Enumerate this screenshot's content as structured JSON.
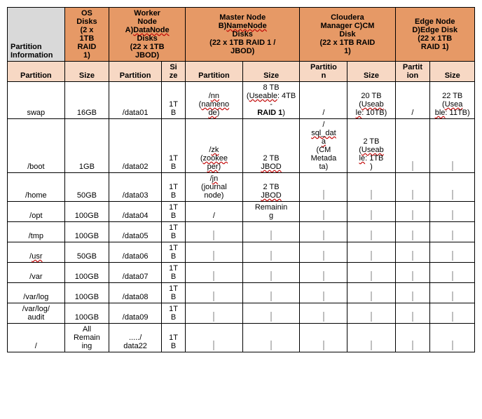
{
  "headers": {
    "corner": "Partition Information",
    "groups": [
      {
        "line1": "OS",
        "line2": "Disks",
        "line3": "(2 x",
        "line4": "1TB",
        "line5": "RAID",
        "line6": "1)"
      },
      {
        "line1": "Worker",
        "line2": "Node",
        "line3a": "A)",
        "line3b": "DataNode",
        "line4": "Disks",
        "line5": "(22 x 1TB",
        "line6": "JBOD)"
      },
      {
        "line1": "Master Node",
        "line2a": "B)",
        "line2b": "NameNode",
        "line3": "Disks",
        "line4": "(22 x 1TB RAID 1 /",
        "line5": "JBOD)"
      },
      {
        "line1": "Cloudera",
        "line2": "Manager C)CM",
        "line3": "Disk",
        "line4": "(22 x 1TB RAID",
        "line5": "1)"
      },
      {
        "line1": "Edge Node",
        "line2": "D)Edge Disk",
        "line3": "(22 x 1TB",
        "line4": "RAID 1)"
      }
    ],
    "sub": {
      "partition": "Partition",
      "size": "Size",
      "sizeShort": "Size",
      "partShort": "Partition"
    }
  },
  "rows": [
    {
      "os_part": "swap",
      "os_size": "16GB",
      "wn_part": "/data01",
      "wn_size": "1TB",
      "mn_part": "/",
      "mn_part_sq": "nn",
      "mn_part2": "(",
      "mn_part3": "nameno",
      "mn_part4": "de",
      "mn_part5": ")",
      "mn_size_l1": "8 TB",
      "mn_size_l2": "(",
      "mn_size_l3": "Useable",
      "mn_size_l4": ": 4TB -",
      "mn_size_l5": "RAID 1",
      "cm_part": "/",
      "cm_size_l1": "20 TB",
      "cm_size_l2": "(",
      "cm_size_l3": "Useab",
      "cm_size_l4": "le",
      "cm_size_l5": ": 10TB)",
      "en_part": "/",
      "en_size_l1": "22 TB",
      "en_size_l2": "(",
      "en_size_l3": "Usea",
      "en_size_l4": "ble",
      "en_size_l5": ": 11TB)"
    },
    {
      "os_part": "/boot",
      "os_size": "1GB",
      "wn_part": "/data02",
      "wn_size": "1TB",
      "mn_part": "/",
      "mn_part_sq": "zk",
      "mn_part2": "(",
      "mn_part3": "zookee",
      "mn_part4": "per",
      "mn_part5": ")",
      "mn_size_l1": "2 TB",
      "mn_size_l2": "JBOD",
      "cm_part": "/",
      "cm_part_sq": "sql_dat",
      "cm_part2": "a",
      "cm_part3": "(CM",
      "cm_part4": "Metada",
      "cm_part5": "ta)",
      "cm_size_l1": "2 TB",
      "cm_size_l2": "(",
      "cm_size_l3": "Useab",
      "cm_size_l4": "le",
      "cm_size_l5": ": 1TB",
      "cm_size_l6": ")"
    },
    {
      "os_part": "/home",
      "os_size": "50GB",
      "wn_part": "/data03",
      "wn_size": "1TB",
      "mn_part": "/",
      "mn_part_sq": "jn",
      "mn_part2": "(journal",
      "mn_part3": "node)",
      "mn_size_l1": "2 TB",
      "mn_size_l2": "JBOD"
    },
    {
      "os_part": "/opt",
      "os_size": "100GB",
      "wn_part": "/data04",
      "wn_size": "1TB",
      "mn_part_plain": "/",
      "mn_size_l1": "Remaining"
    },
    {
      "os_part": "/tmp",
      "os_size": "100GB",
      "wn_part": "/data05",
      "wn_size": "1TB"
    },
    {
      "os_part": "/",
      "os_part_sq": "usr",
      "os_size": "50GB",
      "wn_part": "/data06",
      "wn_size": "1TB"
    },
    {
      "os_part": "/var",
      "os_size": "100GB",
      "wn_part": "/data07",
      "wn_size": "1TB"
    },
    {
      "os_part": "/var/log",
      "os_size": "100GB",
      "wn_part": "/data08",
      "wn_size": "1TB"
    },
    {
      "os_part": "/var/log/audit",
      "os_size": "100GB",
      "wn_part": "/data09",
      "wn_size": "1TB"
    },
    {
      "os_part": "/",
      "os_size": "All Remaining",
      "wn_part": "...../data22",
      "wn_size": "1TB"
    }
  ]
}
